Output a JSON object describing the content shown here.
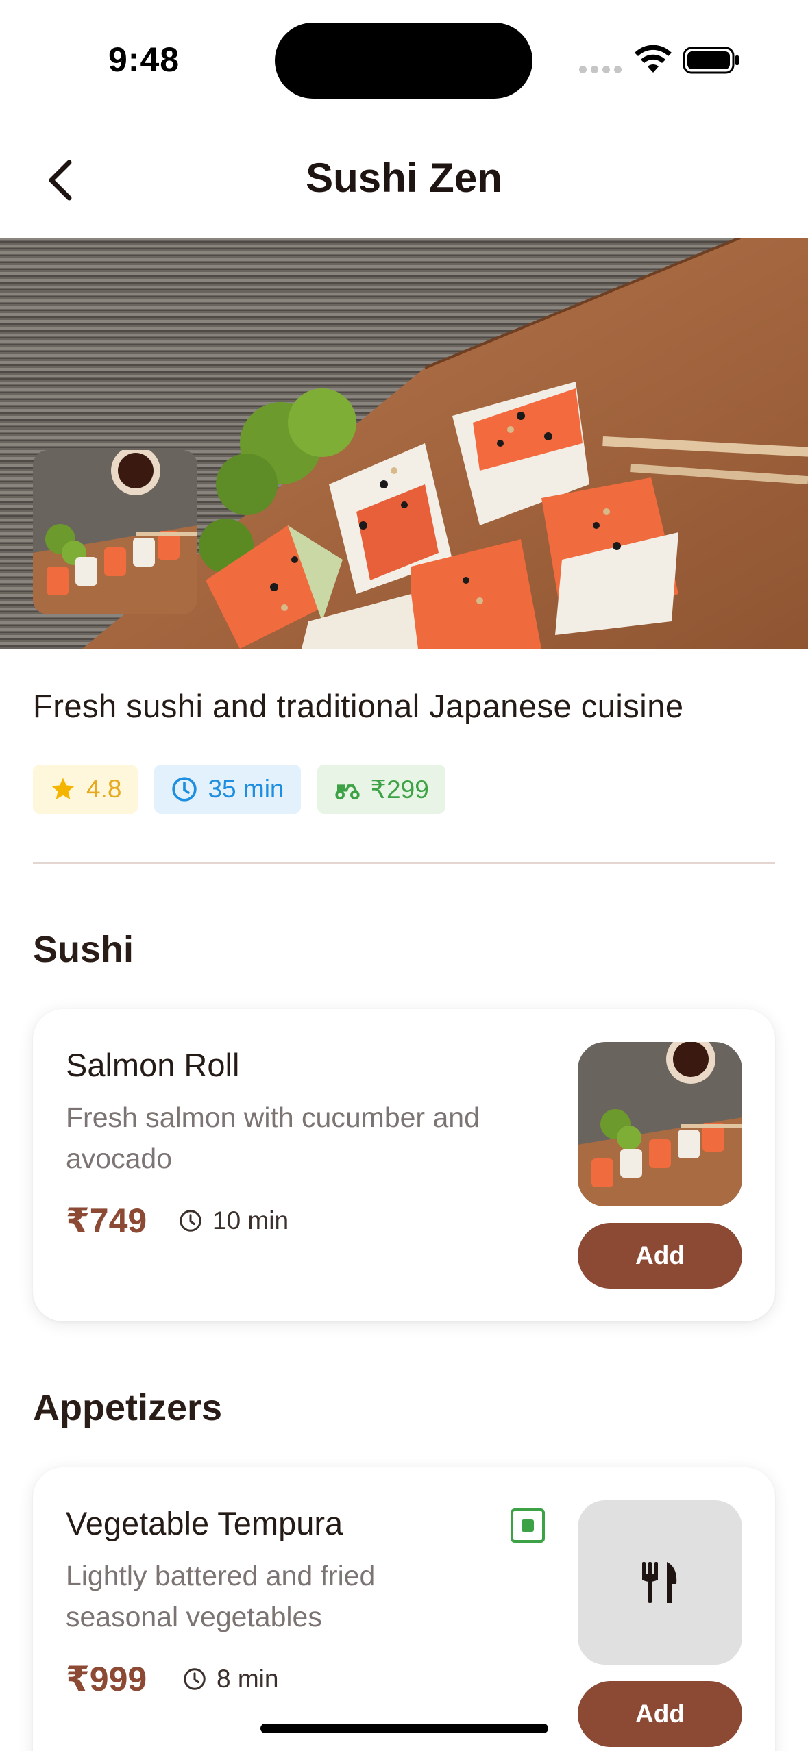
{
  "status_bar": {
    "time": "9:48"
  },
  "header": {
    "title": "Sushi Zen",
    "back_icon": "chevron-left-icon"
  },
  "restaurant": {
    "description": "Fresh sushi and traditional Japanese cuisine",
    "rating": "4.8",
    "delivery_time": "35 min",
    "delivery_fee": "₹299"
  },
  "sections": [
    {
      "title": "Sushi",
      "items": [
        {
          "name": "Salmon Roll",
          "description": "Fresh salmon with cucumber and avocado",
          "price": "₹749",
          "time": "10 min",
          "add_label": "Add",
          "image": "sushi-photo"
        }
      ]
    },
    {
      "title": "Appetizers",
      "items": [
        {
          "name": "Vegetable Tempura",
          "description": "Lightly battered and fried seasonal vegetables",
          "price": "₹999",
          "time": "8 min",
          "add_label": "Add",
          "image": "fork-knife-placeholder-icon",
          "veg": true
        }
      ]
    }
  ],
  "colors": {
    "accent": "#8c4a34",
    "rating": "#e6a91f",
    "time": "#1e8ee0",
    "fee": "#3da246"
  }
}
